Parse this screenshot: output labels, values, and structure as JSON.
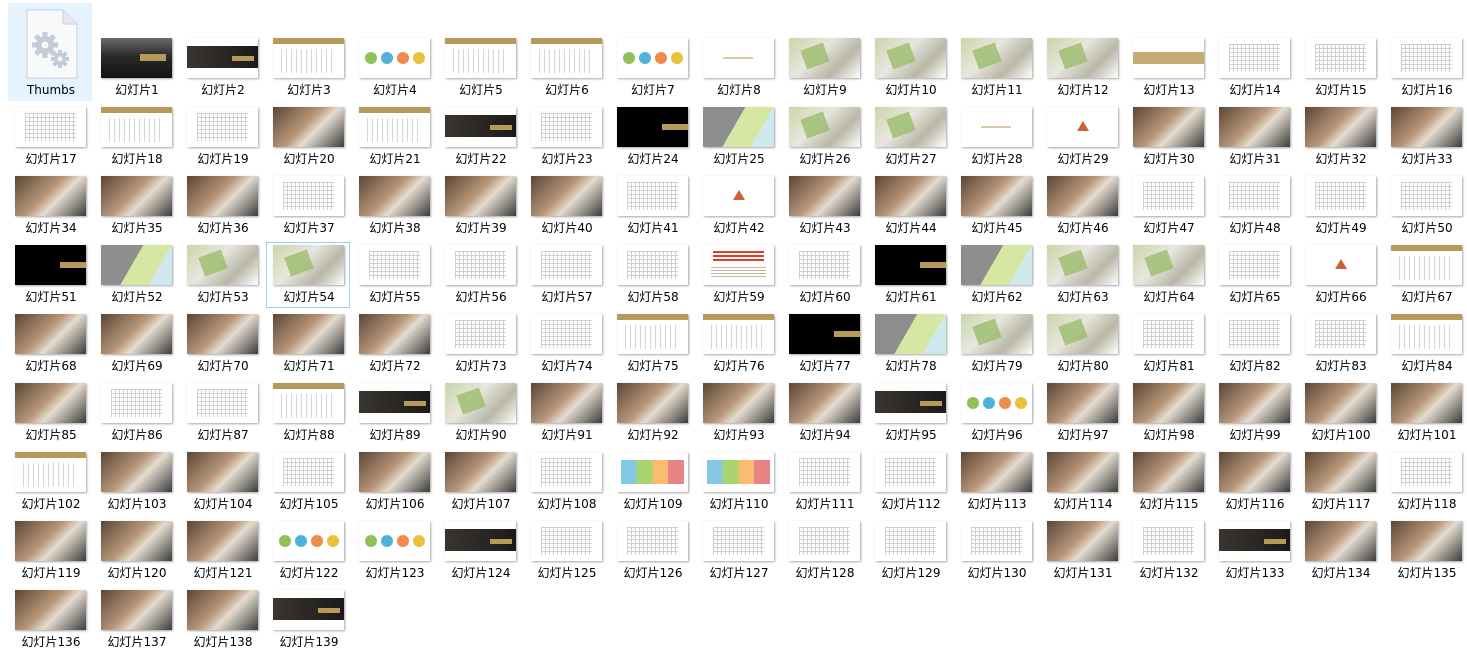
{
  "folder_items": [
    {
      "label": "Thumbs",
      "icon": "system-file-gears-icon",
      "selected": true
    }
  ],
  "slide_label_prefix": "幻灯片",
  "hovered_slide": 54,
  "accent_color": "#b69a5a",
  "selection_color": "#e5f3ff",
  "hover_border_color": "#99d1ff",
  "slides": [
    "dark",
    "dark-band",
    "gold-plan",
    "circles",
    "gold-plan",
    "gold-plan",
    "circles",
    "light",
    "aerial",
    "aerial",
    "aerial",
    "aerial",
    "gold-title",
    "plan",
    "plan",
    "plan",
    "plan",
    "gold-plan",
    "plan",
    "photo",
    "gold-plan",
    "dark-band",
    "plan",
    "black",
    "map",
    "aerial",
    "aerial",
    "light",
    "light-tri",
    "photo",
    "photo",
    "photo",
    "photo",
    "photo",
    "photo",
    "photo",
    "plan",
    "photo",
    "photo",
    "photo",
    "plan",
    "light-tri",
    "photo",
    "photo",
    "photo",
    "photo",
    "plan",
    "plan",
    "plan",
    "plan",
    "black",
    "map",
    "aerial",
    "aerial",
    "plan",
    "plan",
    "plan",
    "plan",
    "red-text",
    "plan",
    "black",
    "map",
    "aerial",
    "aerial",
    "plan",
    "light-tri",
    "gold-plan",
    "photo",
    "photo",
    "photo",
    "photo",
    "photo",
    "plan",
    "plan",
    "gold-plan",
    "gold-plan",
    "black",
    "map",
    "aerial",
    "aerial",
    "plan",
    "plan",
    "plan",
    "gold-plan",
    "photo",
    "plan",
    "plan",
    "gold-plan",
    "dark-band",
    "aerial",
    "photo",
    "photo",
    "photo",
    "photo",
    "dark-band",
    "circles",
    "photo",
    "photo",
    "photo",
    "photo",
    "photo",
    "gold-plan",
    "photo",
    "photo",
    "plan",
    "photo",
    "photo",
    "plan",
    "colorful",
    "colorful",
    "plan",
    "plan",
    "photo",
    "photo",
    "photo",
    "photo",
    "photo",
    "plan",
    "photo",
    "photo",
    "photo",
    "circles",
    "circles",
    "dark-band",
    "plan",
    "plan",
    "plan",
    "plan",
    "plan",
    "plan",
    "photo",
    "plan",
    "dark-band",
    "photo",
    "photo",
    "photo",
    "photo",
    "photo",
    "dark-band"
  ]
}
